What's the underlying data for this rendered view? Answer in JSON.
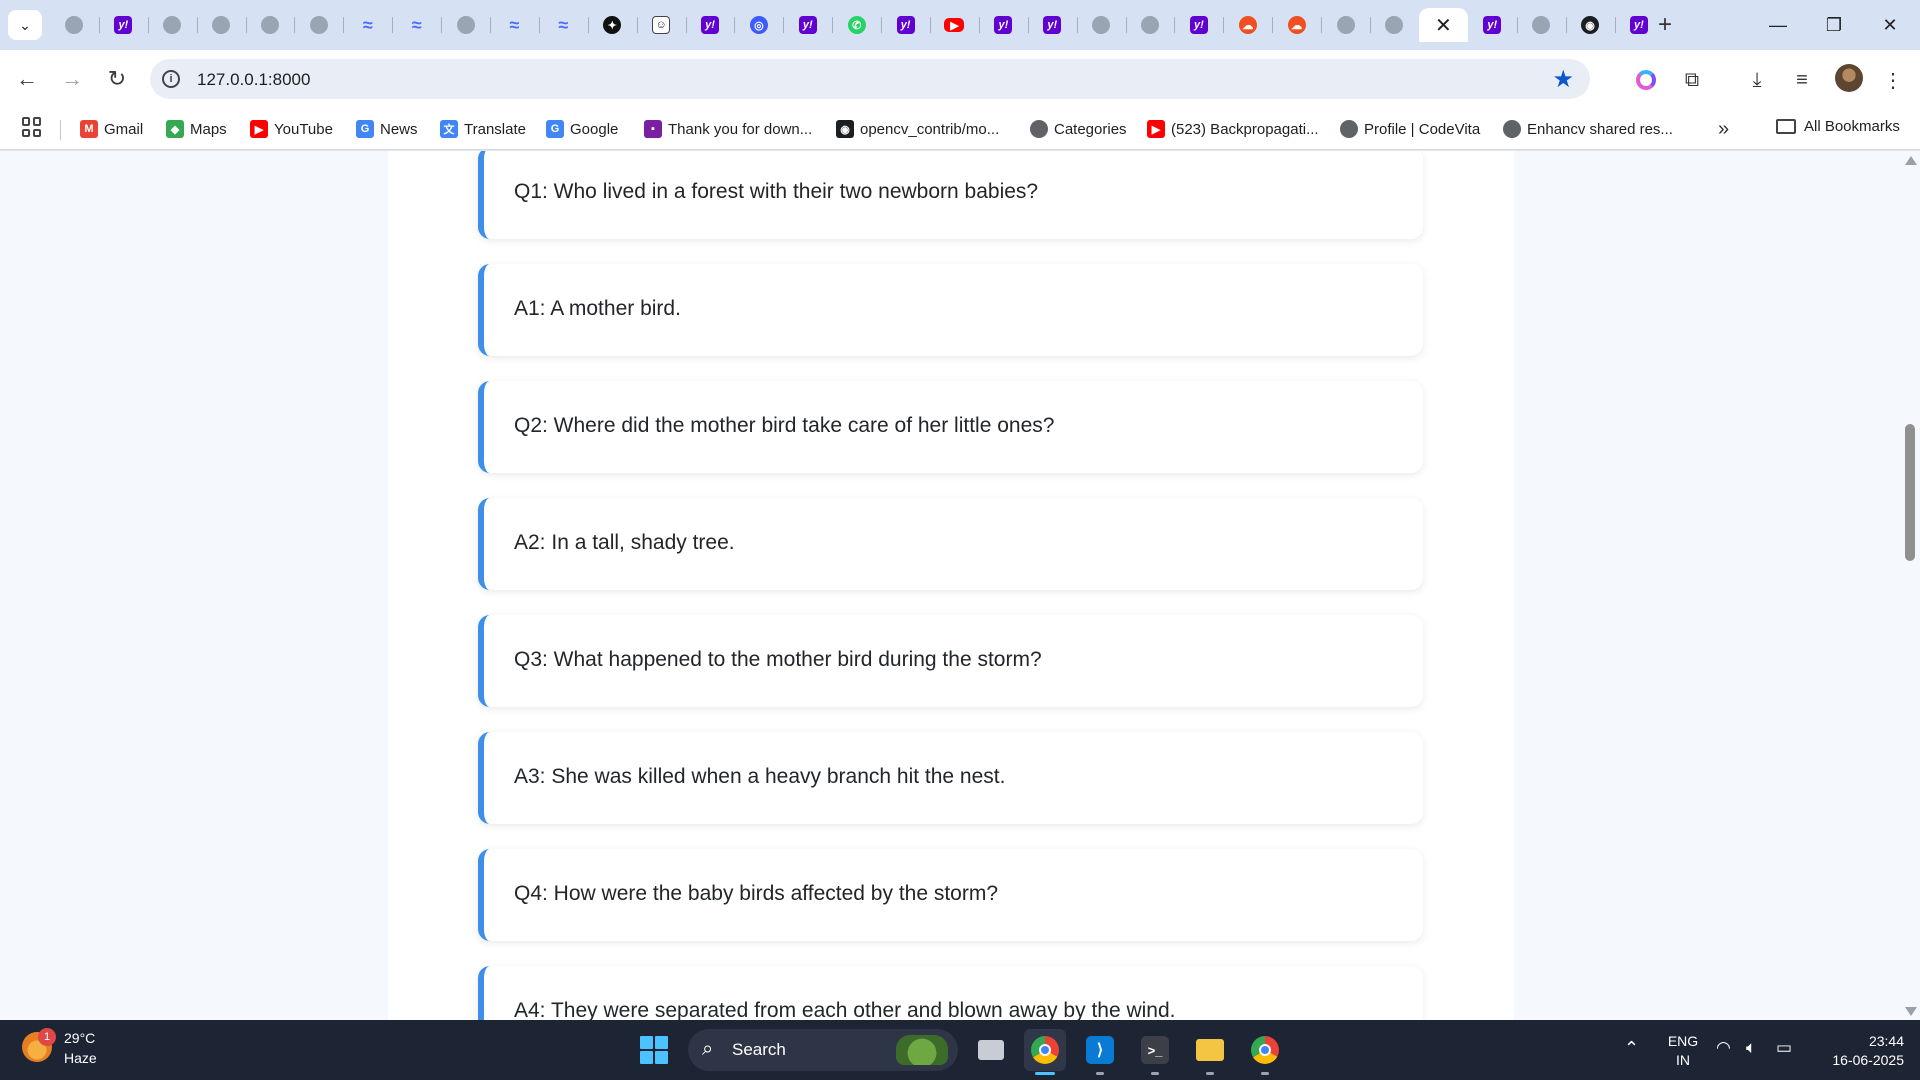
{
  "browser": {
    "tabs": [
      {
        "icon": "globe-icon",
        "glyph": ""
      },
      {
        "icon": "yahoo-icon",
        "glyph": "y!"
      },
      {
        "icon": "globe-icon",
        "glyph": ""
      },
      {
        "icon": "globe-icon",
        "glyph": ""
      },
      {
        "icon": "globe-icon",
        "glyph": ""
      },
      {
        "icon": "globe-icon",
        "glyph": ""
      },
      {
        "icon": "deepseek-icon",
        "glyph": "≈"
      },
      {
        "icon": "deepseek-icon",
        "glyph": "≈"
      },
      {
        "icon": "globe-icon",
        "glyph": ""
      },
      {
        "icon": "deepseek-icon",
        "glyph": "≈"
      },
      {
        "icon": "deepseek-icon",
        "glyph": "≈"
      },
      {
        "icon": "openai-icon",
        "glyph": "✦"
      },
      {
        "icon": "claude-icon",
        "glyph": "☺"
      },
      {
        "icon": "yahoo-icon",
        "glyph": "y!"
      },
      {
        "icon": "blue-circle-icon",
        "glyph": "◎"
      },
      {
        "icon": "yahoo-icon",
        "glyph": "y!"
      },
      {
        "icon": "whatsapp-icon",
        "glyph": "✆"
      },
      {
        "icon": "yahoo-icon",
        "glyph": "y!"
      },
      {
        "icon": "youtube-icon",
        "glyph": "▶"
      },
      {
        "icon": "yahoo-icon",
        "glyph": "y!"
      },
      {
        "icon": "yahoo-icon",
        "glyph": "y!"
      },
      {
        "icon": "globe-icon",
        "glyph": ""
      },
      {
        "icon": "globe-icon",
        "glyph": ""
      },
      {
        "icon": "yahoo-icon",
        "glyph": "y!"
      },
      {
        "icon": "orange-circle-icon",
        "glyph": "☁"
      },
      {
        "icon": "orange-circle-icon",
        "glyph": "☁"
      },
      {
        "icon": "globe-icon",
        "glyph": ""
      },
      {
        "icon": "globe-icon",
        "glyph": ""
      },
      {
        "icon": "close-icon",
        "glyph": "✕",
        "active": true
      },
      {
        "icon": "yahoo-icon",
        "glyph": "y!"
      },
      {
        "icon": "globe-icon",
        "glyph": ""
      },
      {
        "icon": "github-icon",
        "glyph": "◉"
      },
      {
        "icon": "yahoo-icon",
        "glyph": "y!"
      }
    ],
    "address": "127.0.0.1:8000",
    "bookmarks": [
      {
        "label": "Gmail",
        "icon": "gmail-icon",
        "glyph": "M",
        "color": "#ea4335"
      },
      {
        "label": "Maps",
        "icon": "maps-icon",
        "glyph": "◆",
        "color": "#34a853"
      },
      {
        "label": "YouTube",
        "icon": "youtube-icon",
        "glyph": "▶",
        "color": "#ff0000"
      },
      {
        "label": "News",
        "icon": "news-icon",
        "glyph": "G",
        "color": "#4285f4"
      },
      {
        "label": "Translate",
        "icon": "translate-icon",
        "glyph": "文",
        "color": "#4285f4"
      },
      {
        "label": "Google",
        "icon": "google-icon",
        "glyph": "G",
        "color": "#4285f4"
      },
      {
        "label": "Thank you for down...",
        "icon": "app-icon",
        "glyph": "▪",
        "color": "#7b1fa2"
      },
      {
        "label": "opencv_contrib/mo...",
        "icon": "github-icon",
        "glyph": "◉",
        "color": "#1b1f23"
      },
      {
        "label": "Categories",
        "icon": "globe-icon",
        "glyph": "",
        "color": "#5f6368"
      },
      {
        "label": "(523) Backpropagati...",
        "icon": "youtube-icon",
        "glyph": "▶",
        "color": "#ff0000"
      },
      {
        "label": "Profile | CodeVita",
        "icon": "globe-icon",
        "glyph": "",
        "color": "#5f6368"
      },
      {
        "label": "Enhancv shared res...",
        "icon": "globe-icon",
        "glyph": "",
        "color": "#5f6368"
      }
    ],
    "all_bookmarks_label": "All Bookmarks"
  },
  "content": {
    "items": [
      "Q1: Who lived in a forest with their two newborn babies?",
      "A1: A mother bird.",
      "Q2: Where did the mother bird take care of her little ones?",
      "A2: In a tall, shady tree.",
      "Q3: What happened to the mother bird during the storm?",
      "A3: She was killed when a heavy branch hit the nest.",
      "Q4: How were the baby birds affected by the storm?",
      "A4: They were separated from each other and blown away by the wind."
    ],
    "accent_color": "#3f8fe8"
  },
  "taskbar": {
    "weather_badge": "1",
    "temperature": "29°C",
    "condition": "Haze",
    "search_label": "Search",
    "apps": [
      "task-view",
      "chrome",
      "vscode",
      "terminal",
      "file-explorer",
      "chrome-profile"
    ],
    "language": "ENG",
    "region": "IN",
    "time": "23:44",
    "date": "16-06-2025"
  }
}
